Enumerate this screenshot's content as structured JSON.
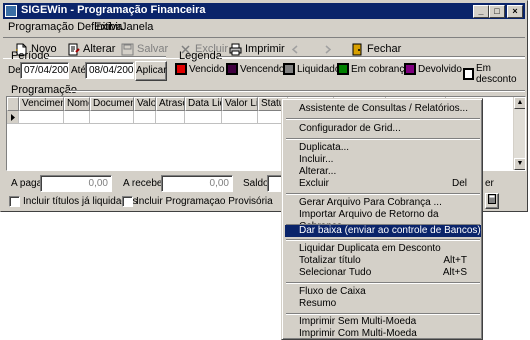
{
  "window": {
    "title": "SIGEWin - Programação Financeira",
    "controls": [
      "_",
      "□",
      "×"
    ]
  },
  "menubar": [
    "Programação Definitiva",
    "Exibir",
    "Janela"
  ],
  "toolbar": {
    "novo": "Novo",
    "alterar": "Alterar",
    "salvar": "Salvar",
    "excluir": "Excluir",
    "imprimir": "Imprimir",
    "fechar": "Fechar"
  },
  "periodo": {
    "title": "Período",
    "de_label": "De",
    "de_value": "07/04/2002",
    "ate_label": "Até",
    "ate_value": "08/04/2002",
    "apply": "Aplicar"
  },
  "legenda": {
    "title": "Legenda",
    "items": [
      {
        "label": "Vencido",
        "color": "#e00000"
      },
      {
        "label": "Vencendo",
        "color": "#400040"
      },
      {
        "label": "Liquidado",
        "color": "#808080"
      },
      {
        "label": "Em cobrança",
        "color": "#008000"
      },
      {
        "label": "Devolvido",
        "color": "#800080"
      },
      {
        "label": "Em desconto",
        "color": "#ffffff"
      }
    ]
  },
  "programacao": {
    "title": "Programação",
    "columns": [
      "Vencimento",
      "Nome",
      "Documento",
      "Valor",
      "Atraso",
      "Data Liq",
      "Valor Liq",
      "Status",
      "",
      "",
      ""
    ]
  },
  "totals": {
    "a_pagar_label": "A pagar:",
    "a_pagar_value": "0,00",
    "a_receber_label": "A receber:",
    "a_receber_value": "0,00",
    "saldo_label": "Saldo:",
    "right_fragment": "er"
  },
  "options": {
    "incluir_liquidados": "Incluir títulos já liquidados",
    "incluir_provisoria": "Incluir Programaçao Provisória"
  },
  "context_menu": {
    "items": [
      {
        "label": "Assistente de Consultas / Relatórios...",
        "shortcut": ""
      },
      {
        "label": "Configurador de Grid...",
        "shortcut": ""
      },
      {
        "label": "Duplicata...",
        "shortcut": ""
      },
      {
        "label": "Incluir...",
        "shortcut": ""
      },
      {
        "label": "Alterar...",
        "shortcut": ""
      },
      {
        "label": "Excluir",
        "shortcut": "Del"
      },
      {
        "label": "Gerar Arquivo Para Cobrança ...",
        "shortcut": ""
      },
      {
        "label": "Importar Arquivo de Retorno da Cobrança ...",
        "shortcut": ""
      },
      {
        "label": "Dar baixa (enviar ao controle de Bancos)",
        "shortcut": ""
      },
      {
        "label": "Liquidar Duplicata em Desconto",
        "shortcut": ""
      },
      {
        "label": "Totalizar título",
        "shortcut": "Alt+T"
      },
      {
        "label": "Selecionar Tudo",
        "shortcut": "Alt+S"
      },
      {
        "label": "Fluxo de Caixa",
        "shortcut": ""
      },
      {
        "label": "Resumo",
        "shortcut": ""
      },
      {
        "label": "Imprimir Sem Multi-Moeda",
        "shortcut": ""
      },
      {
        "label": "Imprimir Com Multi-Moeda",
        "shortcut": ""
      }
    ],
    "highlighted": "Dar baixa (enviar ao controle de Bancos)"
  }
}
